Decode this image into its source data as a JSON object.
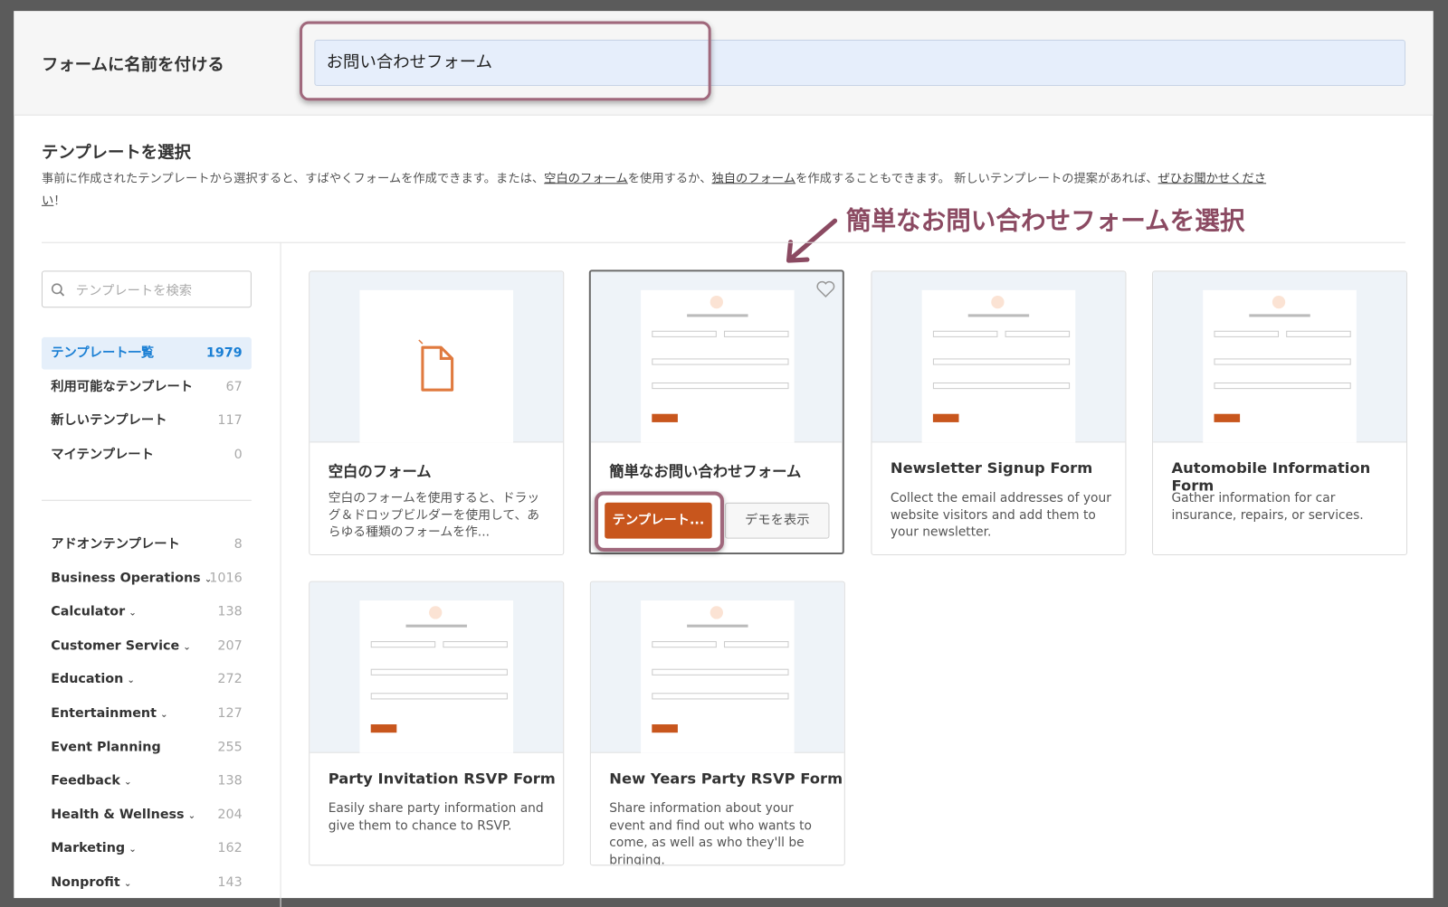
{
  "header": {
    "name_label": "フォームに名前を付ける",
    "name_value": "お問い合わせフォーム"
  },
  "section": {
    "title": "テンプレートを選択",
    "desc_1": "事前に作成されたテンプレートから選択すると、すばやくフォームを作成できます。または、",
    "link_blank": "空白のフォーム",
    "desc_2": "を使用するか、",
    "link_custom": "独自のフォーム",
    "desc_3": "を作成することもできます。 新しいテンプレートの提案があれば、",
    "link_suggest_1": "ぜひお聞かせくださ",
    "link_suggest_2": "い",
    "desc_4": "！"
  },
  "annotation": "簡単なお問い合わせフォームを選択",
  "sidebar": {
    "search_placeholder": "テンプレートを検索",
    "items": [
      {
        "label": "テンプレート一覧",
        "count": "1979",
        "active": true
      },
      {
        "label": "利用可能なテンプレート",
        "count": "67"
      },
      {
        "label": "新しいテンプレート",
        "count": "117"
      },
      {
        "label": "マイテンプレート",
        "count": "0"
      }
    ],
    "categories": [
      {
        "label": "アドオンテンプレート",
        "count": "8",
        "chevron": false
      },
      {
        "label": "Business Operations",
        "count": "1016",
        "chevron": true
      },
      {
        "label": "Calculator",
        "count": "138",
        "chevron": true
      },
      {
        "label": "Customer Service",
        "count": "207",
        "chevron": true
      },
      {
        "label": "Education",
        "count": "272",
        "chevron": true
      },
      {
        "label": "Entertainment",
        "count": "127",
        "chevron": true
      },
      {
        "label": "Event Planning",
        "count": "255",
        "chevron": false
      },
      {
        "label": "Feedback",
        "count": "138",
        "chevron": true
      },
      {
        "label": "Health & Wellness",
        "count": "204",
        "chevron": true
      },
      {
        "label": "Marketing",
        "count": "162",
        "chevron": true
      },
      {
        "label": "Nonprofit",
        "count": "143",
        "chevron": true
      }
    ]
  },
  "cards": [
    {
      "title": "空白のフォーム",
      "desc": "空白のフォームを使用すると、ドラッグ＆ドロップビルダーを使用して、あらゆる種類のフォームを作..."
    },
    {
      "title": "簡単なお問い合わせフォーム",
      "use_label": "テンプレート...",
      "demo_label": "デモを表示"
    },
    {
      "title": "Newsletter Signup Form",
      "desc": "Collect the email addresses of your website visitors and add them to your newsletter."
    },
    {
      "title": "Automobile Information Form",
      "desc": "Gather information for car insurance, repairs, or services."
    },
    {
      "title": "Party Invitation RSVP Form",
      "desc": "Easily share party information and give them to chance to RSVP."
    },
    {
      "title": "New Years Party RSVP Form",
      "desc": "Share information about your event and find out who wants to come, as well as who they'll be bringing."
    }
  ],
  "colors": {
    "accent": "#c8561d",
    "highlight": "#a0687c",
    "active": "#1a7fd4"
  }
}
